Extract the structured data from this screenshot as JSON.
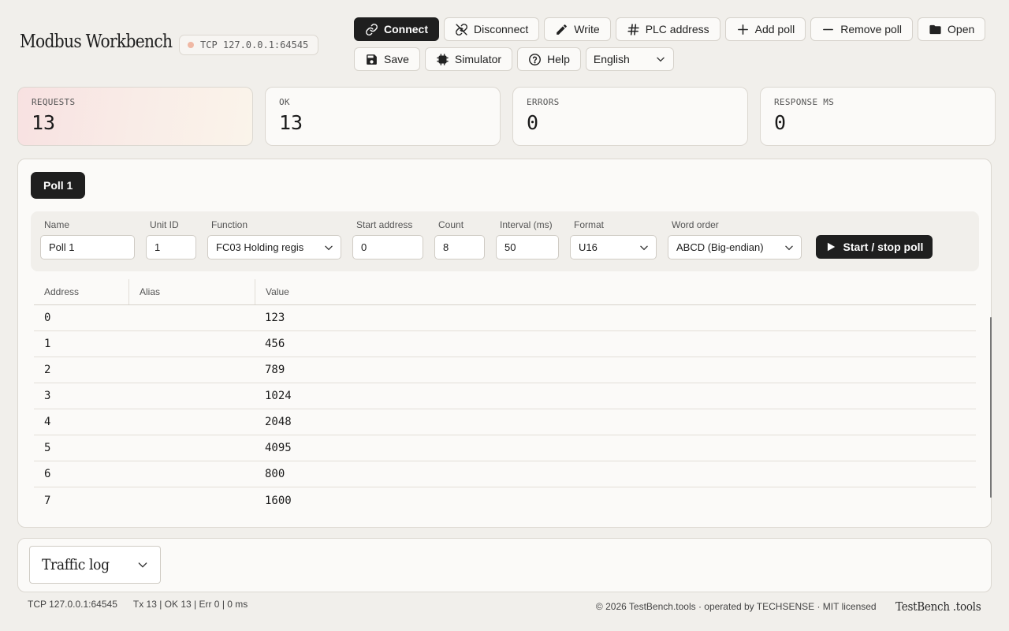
{
  "app": {
    "title": "Modbus Workbench",
    "connection": "TCP 127.0.0.1:64545"
  },
  "toolbar": {
    "connect": "Connect",
    "disconnect": "Disconnect",
    "write": "Write",
    "plc_address": "PLC address",
    "add_poll": "Add poll",
    "remove_poll": "Remove poll",
    "open": "Open",
    "save": "Save",
    "simulator": "Simulator",
    "help": "Help",
    "language": "English"
  },
  "stats": {
    "requests": {
      "label": "REQUESTS",
      "value": "13"
    },
    "ok": {
      "label": "OK",
      "value": "13"
    },
    "errors": {
      "label": "ERRORS",
      "value": "0"
    },
    "response": {
      "label": "RESPONSE MS",
      "value": "0"
    }
  },
  "poll": {
    "tab": "Poll 1",
    "fields": {
      "name": {
        "label": "Name",
        "value": "Poll 1"
      },
      "unit_id": {
        "label": "Unit ID",
        "value": "1"
      },
      "function": {
        "label": "Function",
        "value": "FC03 Holding regis"
      },
      "start": {
        "label": "Start address",
        "value": "0"
      },
      "count": {
        "label": "Count",
        "value": "8"
      },
      "interval": {
        "label": "Interval (ms)",
        "value": "50"
      },
      "format": {
        "label": "Format",
        "value": "U16"
      },
      "word_order": {
        "label": "Word order",
        "value": "ABCD (Big-endian)"
      }
    },
    "run_button": "Start / stop poll"
  },
  "table": {
    "headers": {
      "address": "Address",
      "alias": "Alias",
      "value": "Value"
    },
    "rows": [
      {
        "address": "0",
        "alias": "",
        "value": "123"
      },
      {
        "address": "1",
        "alias": "",
        "value": "456"
      },
      {
        "address": "2",
        "alias": "",
        "value": "789"
      },
      {
        "address": "3",
        "alias": "",
        "value": "1024"
      },
      {
        "address": "4",
        "alias": "",
        "value": "2048"
      },
      {
        "address": "5",
        "alias": "",
        "value": "4095"
      },
      {
        "address": "6",
        "alias": "",
        "value": "800"
      },
      {
        "address": "7",
        "alias": "",
        "value": "1600"
      }
    ]
  },
  "log": {
    "label": "Traffic log"
  },
  "footer": {
    "connection": "TCP 127.0.0.1:64545",
    "counters": "Tx 13 | OK 13 | Err 0 | 0 ms",
    "copyright": "© 2026 TestBench.tools · operated by TECHSENSE · MIT licensed",
    "brand": "TestBench .tools"
  }
}
